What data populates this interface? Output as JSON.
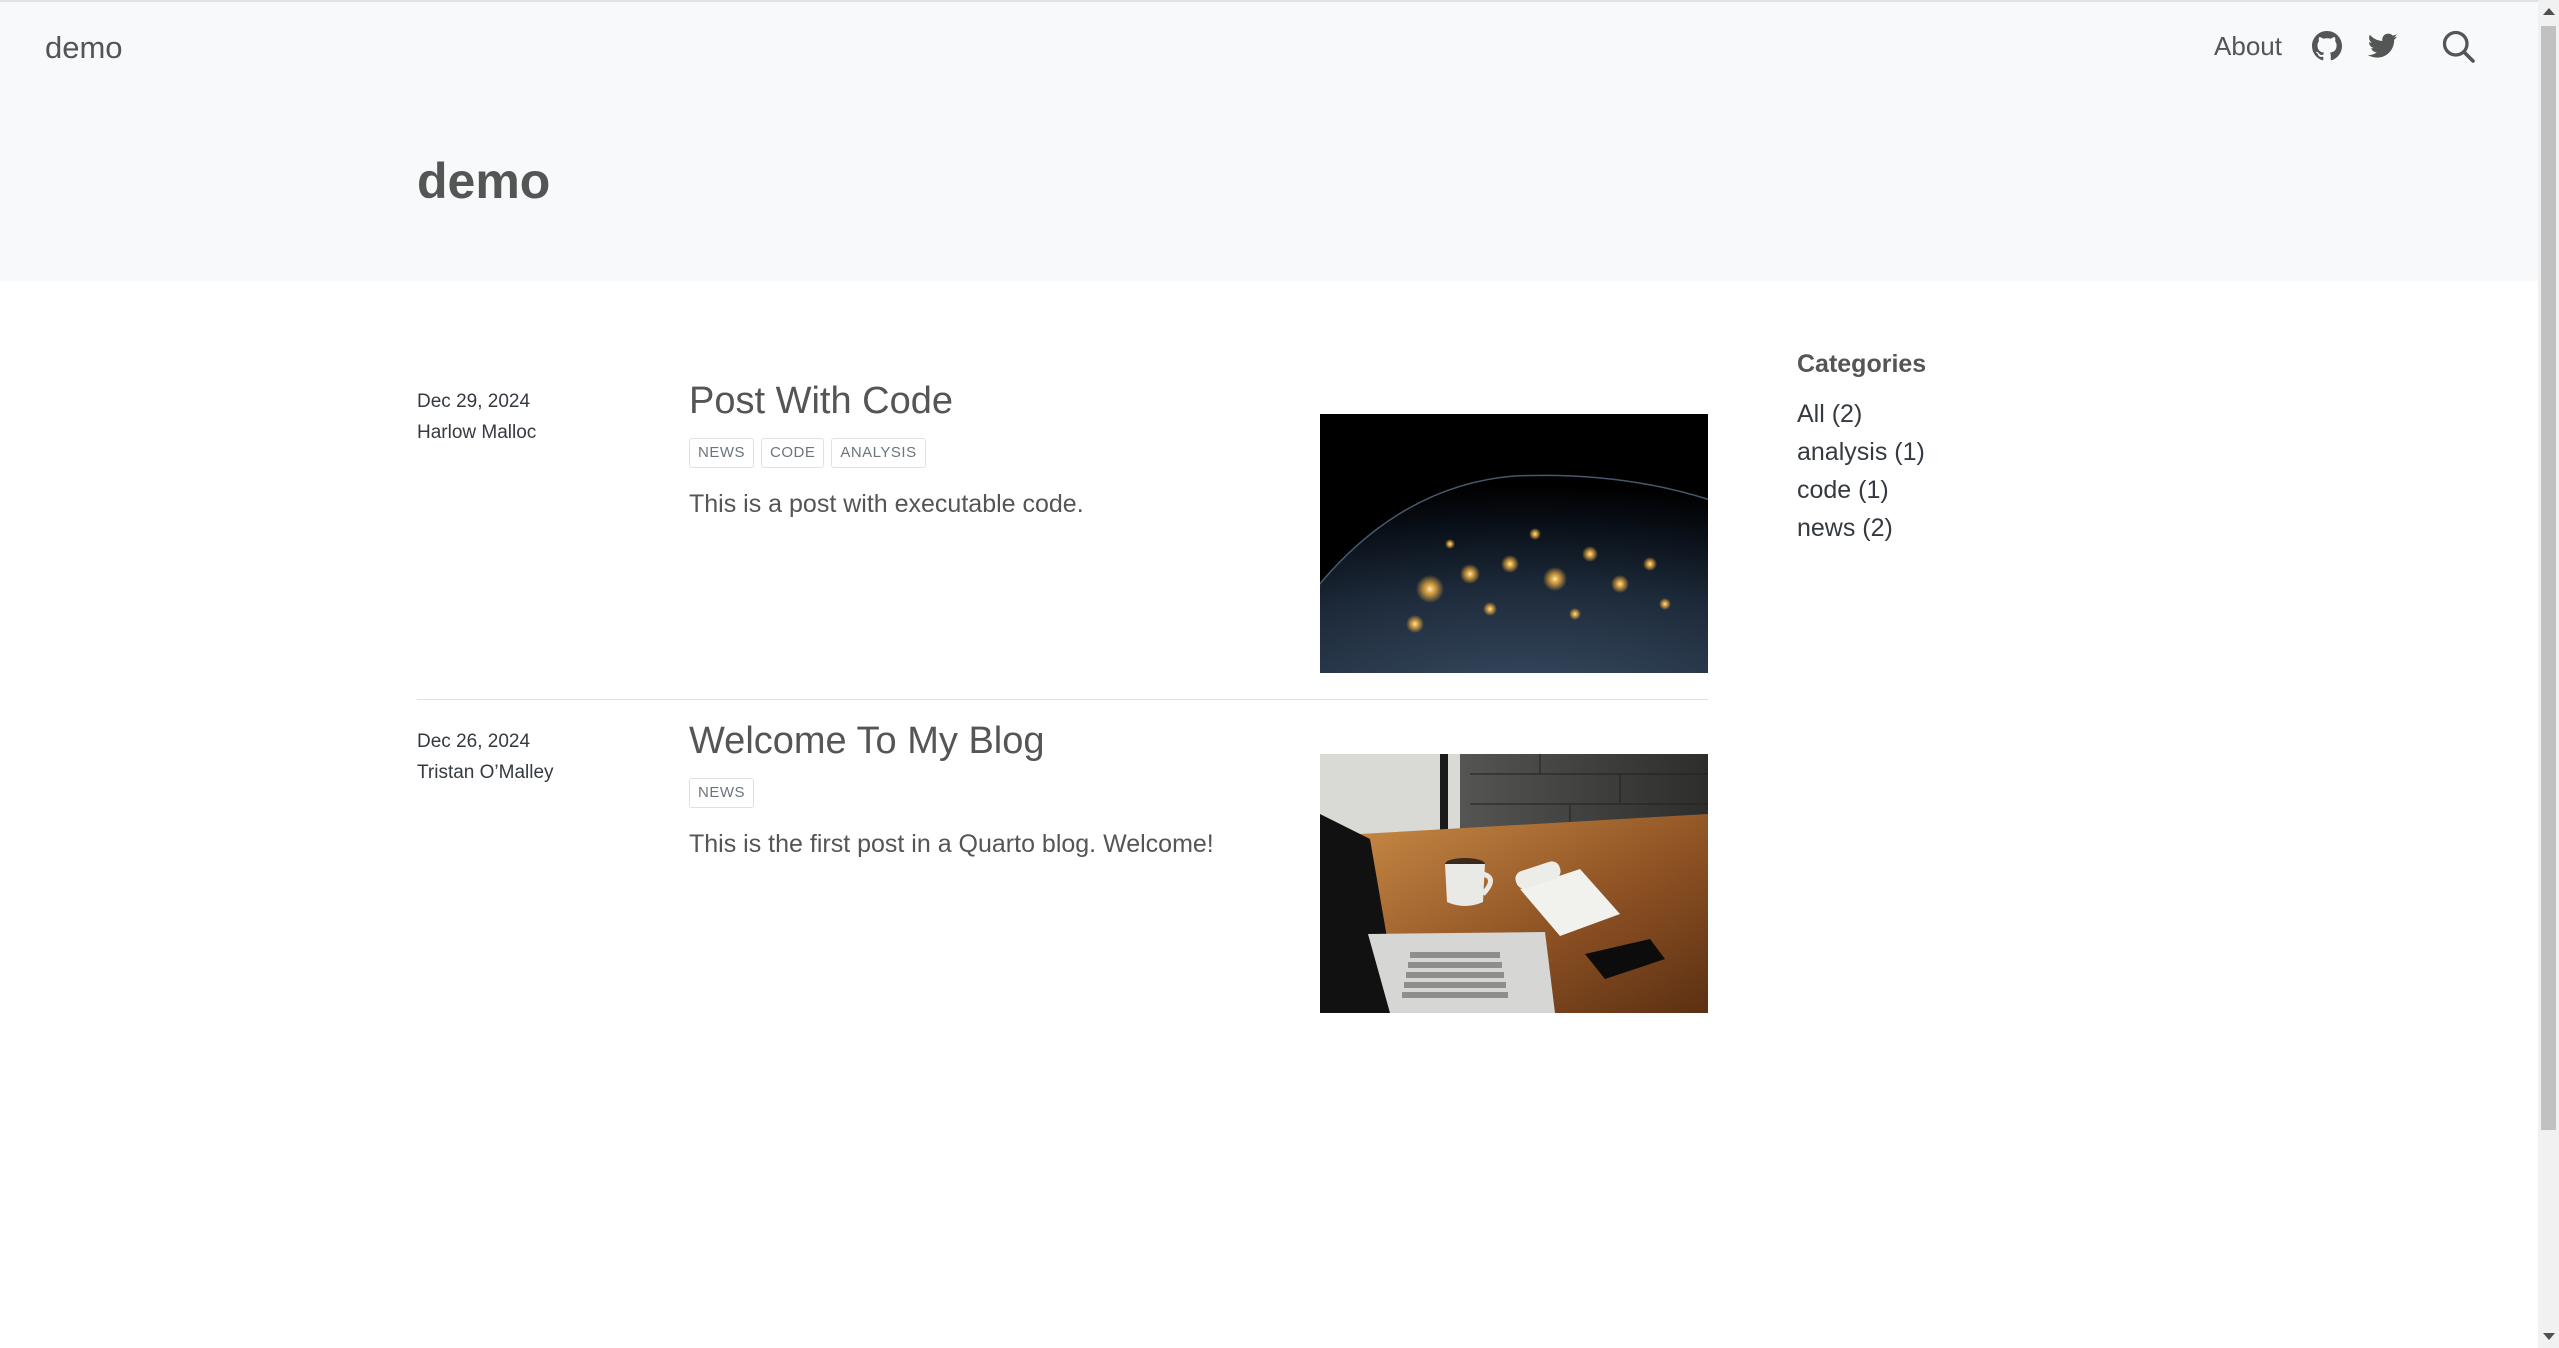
{
  "navbar": {
    "brand": "demo",
    "about_label": "About",
    "icons": [
      "github-icon",
      "twitter-icon",
      "search-icon"
    ]
  },
  "hero": {
    "title": "demo"
  },
  "posts": [
    {
      "date": "Dec 29, 2024",
      "author": "Harlow Malloc",
      "title": "Post With Code",
      "categories": [
        "NEWS",
        "CODE",
        "ANALYSIS"
      ],
      "description": "This is a post with executable code."
    },
    {
      "date": "Dec 26, 2024",
      "author": "Tristan O’Malley",
      "title": "Welcome To My Blog",
      "categories": [
        "NEWS"
      ],
      "description": "This is the first post in a Quarto blog. Welcome!"
    }
  ],
  "sidebar": {
    "title": "Categories",
    "items": [
      "All (2)",
      "analysis (1)",
      "code (1)",
      "news (2)"
    ]
  },
  "colors": {
    "hero_bg": "#f8f9fa",
    "text": "#545555",
    "pill_border": "#dee2e6"
  }
}
